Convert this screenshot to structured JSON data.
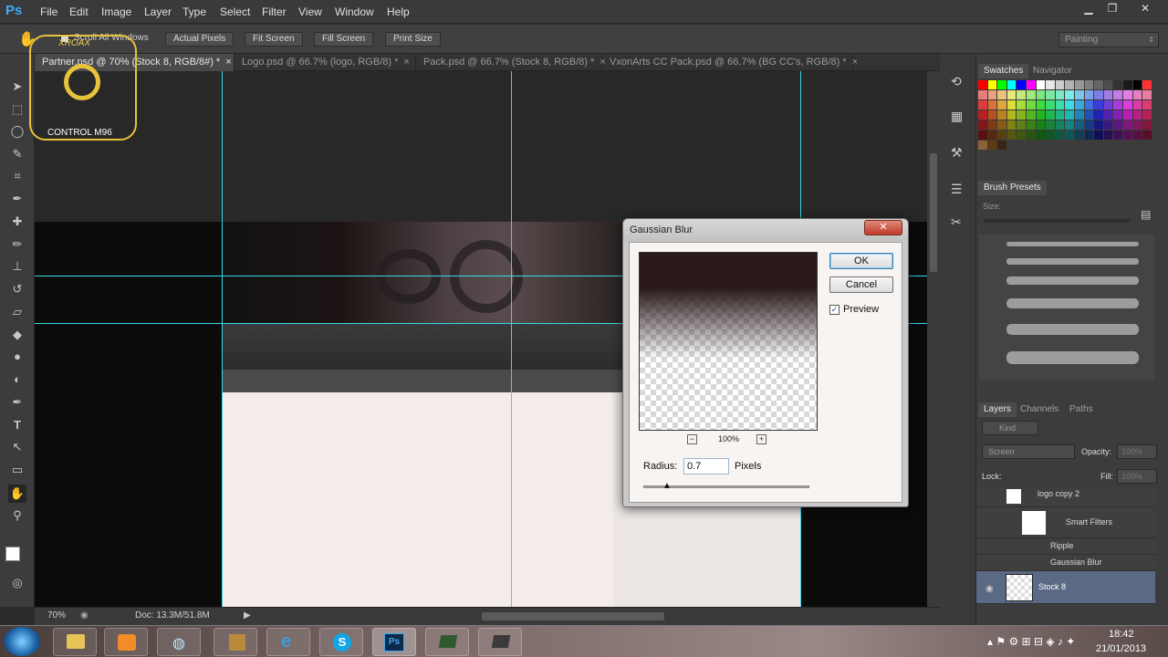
{
  "app": {
    "logo": "Ps"
  },
  "menu": [
    "File",
    "Edit",
    "Image",
    "Layer",
    "Type",
    "Select",
    "Filter",
    "View",
    "Window",
    "Help"
  ],
  "options": {
    "scroll_all_windows": "Scroll All Windows",
    "buttons": [
      "Actual Pixels",
      "Fit Screen",
      "Fill Screen",
      "Print Size"
    ],
    "workspace": "Painting"
  },
  "tabs": [
    {
      "label": "Partner.psd @ 70% (Stock 8, RGB/8#) *",
      "active": true
    },
    {
      "label": "Logo.psd @ 66.7% (logo, RGB/8) *",
      "active": false
    },
    {
      "label": "Pack.psd @ 66.7% (Stock 8, RGB/8) *",
      "active": false
    },
    {
      "label": "VxonArts CC Pack.psd @ 66.7% (BG CC's, RGB/8) *",
      "active": false
    }
  ],
  "watermark": {
    "top": "XROAX",
    "bottom": "CONTROL M96"
  },
  "status": {
    "zoom": "70%",
    "doc": "Doc: 13.3M/51.8M"
  },
  "dialog": {
    "title": "Gaussian Blur",
    "ok": "OK",
    "cancel": "Cancel",
    "preview_label": "Preview",
    "preview_checked": true,
    "zoom": "100%",
    "radius_label": "Radius:",
    "radius_value": "0.7",
    "unit": "Pixels"
  },
  "panels": {
    "swatch_tabs": [
      "Swatches",
      "Navigator"
    ],
    "brush_presets": "Brush Presets",
    "size_label": "Size:",
    "layer_tabs": [
      "Layers",
      "Channels",
      "Paths"
    ],
    "kind": "Kind",
    "blend_mode": "Screen",
    "opacity_label": "Opacity:",
    "opacity_value": "100%",
    "lock_label": "Lock:",
    "fill_label": "Fill:",
    "fill_value": "100%",
    "layers": [
      {
        "name": "logo copy 2"
      },
      {
        "name": "Smart Filters"
      },
      {
        "name": "Ripple"
      },
      {
        "name": "Gaussian Blur"
      },
      {
        "name": "Stock 8"
      }
    ]
  },
  "clock": {
    "time": "18:42",
    "date": "21/01/2013"
  }
}
